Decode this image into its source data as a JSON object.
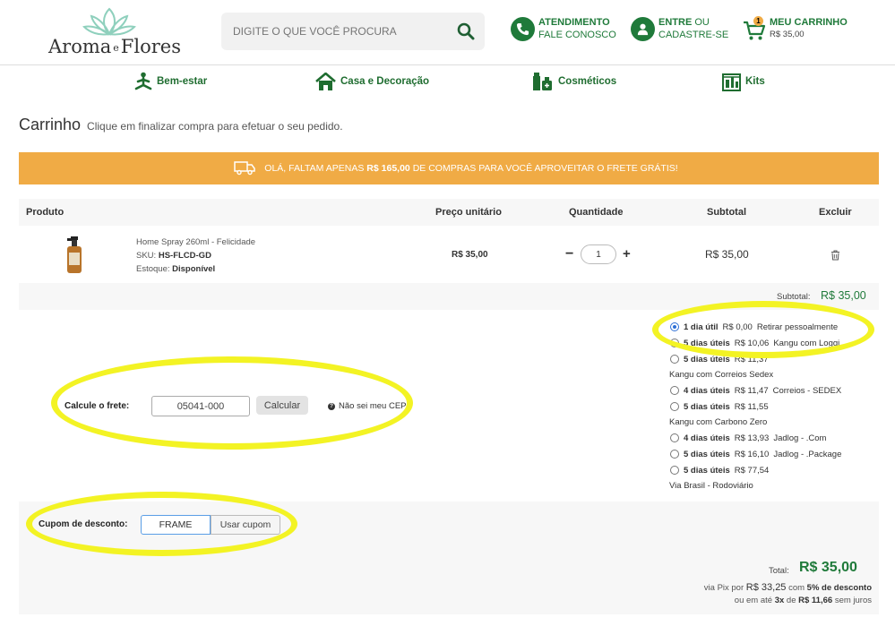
{
  "header": {
    "logo": {
      "word1": "Aroma",
      "connector": "e",
      "word2": "Flores"
    },
    "search": {
      "placeholder": "DIGITE O QUE VOCÊ PROCURA"
    },
    "support": {
      "line1": "ATENDIMENTO",
      "line2": "FALE CONOSCO"
    },
    "account": {
      "line1": "ENTRE",
      "line1b": "OU",
      "line2": "CADASTRE-SE"
    },
    "cart": {
      "line1": "MEU CARRINHO",
      "line2": "R$ 35,00",
      "badge": "1"
    }
  },
  "nav": {
    "items": [
      {
        "label": "Bem-estar",
        "icon": "meditation-icon"
      },
      {
        "label": "Casa e Decoração",
        "icon": "house-icon"
      },
      {
        "label": "Cosméticos",
        "icon": "cosmetics-icon"
      },
      {
        "label": "Kits",
        "icon": "kits-icon"
      }
    ]
  },
  "page": {
    "title": "Carrinho",
    "subtitle": "Clique em finalizar compra para efetuar o seu pedido."
  },
  "banner": {
    "pre": "OLÁ, FALTAM APENAS",
    "amount": "R$ 165,00",
    "post": "DE COMPRAS PARA VOCÊ APROVEITAR O FRETE GRÁTIS!"
  },
  "table": {
    "headers": {
      "product": "Produto",
      "unit_price": "Preço unitário",
      "quantity": "Quantidade",
      "subtotal": "Subtotal",
      "remove": "Excluir"
    },
    "item": {
      "name": "Home Spray 260ml - Felicidade",
      "sku_label": "SKU:",
      "sku": "HS-FLCD-GD",
      "stock_label": "Estoque:",
      "stock": "Disponível",
      "unit_price": "R$ 35,00",
      "quantity": "1",
      "minus": "−",
      "plus": "+",
      "subtotal": "R$ 35,00"
    },
    "subtotal_label": "Subtotal:",
    "subtotal_value": "R$ 35,00"
  },
  "freight": {
    "label": "Calcule o frete:",
    "cep": "05041-000",
    "calc_button": "Calcular",
    "unknown_cep": "Não sei meu CEP",
    "options": [
      {
        "days": "1 dia útil",
        "price": "R$ 0,00",
        "carrier": "Retirar pessoalmente",
        "checked": true
      },
      {
        "days": "5 dias úteis",
        "price": "R$ 10,06",
        "carrier": "Kangu com Loggi",
        "checked": false
      },
      {
        "days": "5 dias úteis",
        "price": "R$ 11,37",
        "carrier": "Kangu com Correios Sedex",
        "checked": false
      },
      {
        "days": "4 dias úteis",
        "price": "R$ 11,47",
        "carrier": "Correios - SEDEX",
        "checked": false
      },
      {
        "days": "5 dias úteis",
        "price": "R$ 11,55",
        "carrier": "Kangu com Carbono Zero",
        "checked": false
      },
      {
        "days": "4 dias úteis",
        "price": "R$ 13,93",
        "carrier": "Jadlog - .Com",
        "checked": false
      },
      {
        "days": "5 dias úteis",
        "price": "R$ 16,10",
        "carrier": "Jadlog - .Package",
        "checked": false
      },
      {
        "days": "5 dias úteis",
        "price": "R$ 77,54",
        "carrier": "Via Brasil - Rodoviário",
        "checked": false
      }
    ]
  },
  "coupon": {
    "label": "Cupom de desconto:",
    "value": "FRAME",
    "button": "Usar cupom"
  },
  "totals": {
    "label": "Total:",
    "value": "R$ 35,00",
    "pix_pre": "via Pix por",
    "pix_amount": "R$ 33,25",
    "pix_mid": "com",
    "pix_discount": "5% de desconto",
    "inst_pre": "ou em até",
    "inst_times": "3x",
    "inst_mid": "de",
    "inst_amount": "R$ 11,66",
    "inst_post": "sem juros"
  },
  "colors": {
    "brand_green": "#1f7a3a",
    "banner_orange": "#f0ab45",
    "highlight_yellow": "#f3f324"
  }
}
